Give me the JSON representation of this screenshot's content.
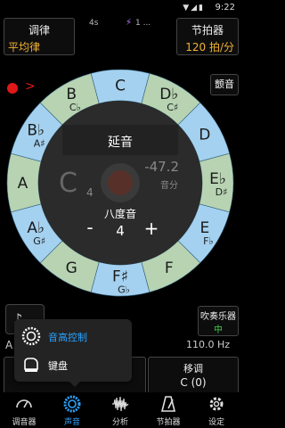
{
  "status": {
    "time": "9:22",
    "counter": "4s",
    "mid_text": "1 ..."
  },
  "header": {
    "temperament": {
      "title": "调律",
      "value": "平均律"
    },
    "metronome": {
      "title": "节拍器",
      "value": "120 拍/分"
    }
  },
  "controls": {
    "transpose_short": "颤音"
  },
  "wheel": {
    "notes": [
      {
        "main": "C",
        "alt": "",
        "type": "blue"
      },
      {
        "main": "D♭",
        "alt": "C♯",
        "type": "green"
      },
      {
        "main": "D",
        "alt": "",
        "type": "blue"
      },
      {
        "main": "E♭",
        "alt": "D♯",
        "type": "green"
      },
      {
        "main": "E",
        "alt": "F♭",
        "type": "blue"
      },
      {
        "main": "F",
        "alt": "",
        "type": "green"
      },
      {
        "main": "F♯",
        "alt": "G♭",
        "type": "blue"
      },
      {
        "main": "G",
        "alt": "",
        "type": "green"
      },
      {
        "main": "A♭",
        "alt": "G♯",
        "type": "blue"
      },
      {
        "main": "A",
        "alt": "",
        "type": "green"
      },
      {
        "main": "B♭",
        "alt": "A♯",
        "type": "blue"
      },
      {
        "main": "B",
        "alt": "C♭",
        "type": "green"
      }
    ],
    "sustain_label": "延音",
    "current_note": "C",
    "current_octave": "4",
    "cents_value": "-47.2",
    "cents_label": "音分",
    "octave_label": "八度音",
    "octave_value": "4",
    "minus": "-",
    "plus": "+"
  },
  "bottom": {
    "wind_instrument": {
      "title": "吹奏乐器",
      "value": "中"
    },
    "frequency": "110.0 Hz",
    "letter": "A",
    "transpose": {
      "title": "移调",
      "value": "C (0)"
    }
  },
  "popup": {
    "items": [
      {
        "label": "音高控制"
      },
      {
        "label": "键盘"
      }
    ]
  },
  "nav": [
    {
      "label": "调音器",
      "icon": "tuner-icon"
    },
    {
      "label": "声音",
      "icon": "sound-icon"
    },
    {
      "label": "分析",
      "icon": "analysis-icon"
    },
    {
      "label": "节拍器",
      "icon": "metronome-icon"
    },
    {
      "label": "设定",
      "icon": "settings-icon"
    }
  ],
  "colors": {
    "blue": "#a4d1ef",
    "green": "#b7d3b2",
    "accent": "#f3b233",
    "active": "#2aa3ff",
    "record": "#e01818"
  }
}
